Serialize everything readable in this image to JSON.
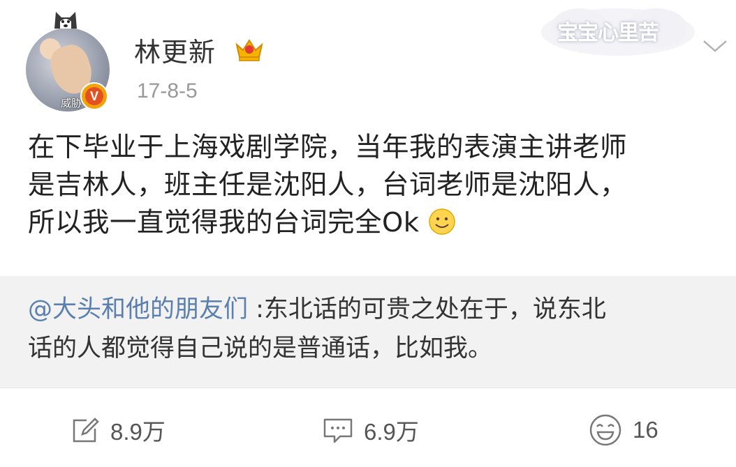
{
  "post": {
    "username": "林更新",
    "avatar_caption": "威胁",
    "verified_mark": "V",
    "date": "17-8-5",
    "body_lines": [
      "在下毕业于上海戏剧学院，当年我的表演主讲老师",
      "是吉林人，班主任是沈阳人，台词老师是沈阳人，",
      "所以我一直觉得我的台词完全Ok"
    ],
    "watermark": "宝宝心里苦"
  },
  "retweet": {
    "mention": "@大头和他的朋友们",
    "line1_rest": " :东北话的可贵之处在于，说东北",
    "line2": "话的人都觉得自己说的是普通话，比如我。"
  },
  "actions": {
    "repost_count": "8.9万",
    "comment_count": "6.9万",
    "like_count": "16"
  },
  "colors": {
    "mention": "#5b7fae",
    "date": "#999999",
    "retweet_bg": "#f2f2f2",
    "badge": "#e35120"
  },
  "icons": [
    "crown-icon",
    "chevron-down-icon",
    "smile-icon",
    "edit-icon",
    "comment-icon",
    "laugh-icon"
  ]
}
